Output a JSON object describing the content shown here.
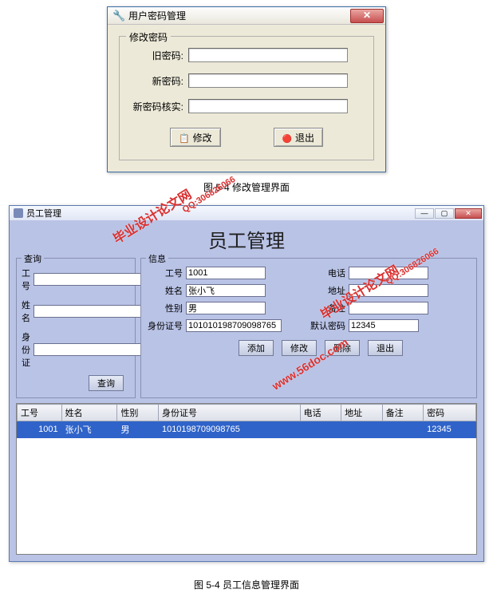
{
  "dialog1": {
    "title": "用户密码管理",
    "groupTitle": "修改密码",
    "oldPwdLabel": "旧密码:",
    "newPwdLabel": "新密码:",
    "confirmPwdLabel": "新密码核实:",
    "modifyBtn": "修改",
    "exitBtn": "退出"
  },
  "caption1": "图 5-4 修改管理界面",
  "dialog2": {
    "title": "员工管理",
    "heading": "员工管理",
    "queryPanel": {
      "title": "查询",
      "idLabel": "工号",
      "nameLabel": "姓名",
      "idCardLabel": "身份证",
      "queryBtn": "查询"
    },
    "infoPanel": {
      "title": "信息",
      "idLabel": "工号",
      "idValue": "1001",
      "nameLabel": "姓名",
      "nameValue": "张小飞",
      "genderLabel": "性别",
      "genderValue": "男",
      "idCardLabel": "身份证号",
      "idCardValue": "101010198709098765",
      "phoneLabel": "电话",
      "phoneValue": "",
      "addrLabel": "地址",
      "addrValue": "",
      "remarkLabel": "备注",
      "remarkValue": "",
      "pwdLabel": "默认密码",
      "pwdValue": "12345",
      "addBtn": "添加",
      "modifyBtn": "修改",
      "deleteBtn": "删除",
      "exitBtn": "退出"
    },
    "grid": {
      "columns": [
        "工号",
        "姓名",
        "性别",
        "身份证号",
        "电话",
        "地址",
        "备注",
        "密码"
      ],
      "rows": [
        {
          "id": "1001",
          "name": "张小飞",
          "gender": "男",
          "idcard": "1010198709098765",
          "phone": "",
          "addr": "",
          "remark": "",
          "pwd": "12345"
        }
      ]
    }
  },
  "caption2": "图 5-4 员工信息管理界面",
  "watermark": {
    "brand": "毕业设计论文网",
    "qq": "QQ:306826066",
    "url": "www.56doc.com"
  }
}
